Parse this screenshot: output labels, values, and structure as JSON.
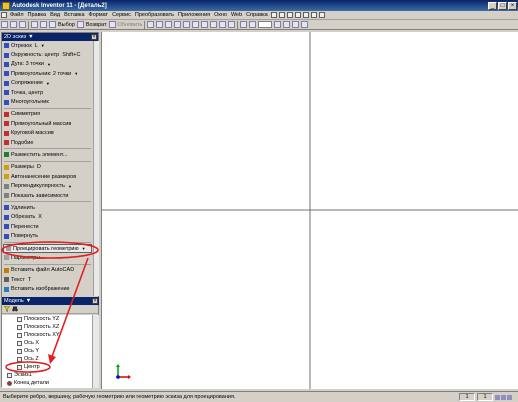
{
  "window": {
    "title": "Autodesk Inventor 11 - [Деталь2]",
    "buttons": {
      "minimize": "_",
      "maximize": "□",
      "close": "×"
    }
  },
  "menu": {
    "items": [
      "Файл",
      "Правка",
      "Вид",
      "Вставка",
      "Формат",
      "Сервис",
      "Преобразовать",
      "Приложения",
      "Окно",
      "Web",
      "Справка"
    ]
  },
  "toolbar": {
    "select_label": "Выбор",
    "return_label": "Возврат",
    "update_label": "Обновить"
  },
  "sketch_panel": {
    "title": "2D эскиз",
    "tools": [
      {
        "label": "Отрезок",
        "shortcut": "L",
        "arrow": "▼"
      },
      {
        "label": "Окружность: центр",
        "shortcut": "Shift+C",
        "arrow": ""
      },
      {
        "label": "Дуга: 3 точки",
        "shortcut": "",
        "arrow": "▼"
      },
      {
        "label": "Прямоугольник: 2 точки",
        "shortcut": "",
        "arrow": "▼"
      },
      {
        "label": "Сопряжение",
        "shortcut": "",
        "arrow": "▼"
      },
      {
        "label": "Точка, центр",
        "shortcut": "",
        "arrow": ""
      },
      {
        "label": "Многоугольник",
        "shortcut": "",
        "arrow": ""
      },
      {
        "label": "Симметрия",
        "shortcut": "",
        "arrow": ""
      },
      {
        "label": "Прямоугольный массив",
        "shortcut": "",
        "arrow": ""
      },
      {
        "label": "Круговой массив",
        "shortcut": "",
        "arrow": ""
      },
      {
        "label": "Подобие",
        "shortcut": "",
        "arrow": ""
      },
      {
        "label": "Разместить элемент...",
        "shortcut": "",
        "arrow": ""
      },
      {
        "label": "Размеры",
        "shortcut": "D",
        "arrow": ""
      },
      {
        "label": "Автонанесение размеров",
        "shortcut": "",
        "arrow": ""
      },
      {
        "label": "Перпендикулярность",
        "shortcut": "",
        "arrow": "▼"
      },
      {
        "label": "Показать зависимости",
        "shortcut": "",
        "arrow": ""
      },
      {
        "label": "Удлинить",
        "shortcut": "",
        "arrow": ""
      },
      {
        "label": "Обрезать",
        "shortcut": "X",
        "arrow": ""
      },
      {
        "label": "Перенести",
        "shortcut": "",
        "arrow": ""
      },
      {
        "label": "Повернуть",
        "shortcut": "",
        "arrow": ""
      },
      {
        "label": "Проецировать геометрию",
        "shortcut": "",
        "arrow": "▼"
      },
      {
        "label": "Параметры...",
        "shortcut": "",
        "arrow": ""
      },
      {
        "label": "Вставить файл AutoCAD",
        "shortcut": "",
        "arrow": ""
      },
      {
        "label": "Текст",
        "shortcut": "T",
        "arrow": ""
      },
      {
        "label": "Вставить изображение",
        "shortcut": "",
        "arrow": ""
      }
    ]
  },
  "model_panel": {
    "title": "Модель",
    "tree": [
      {
        "label": "Плоскость YZ",
        "indent": 3
      },
      {
        "label": "Плоскость XZ",
        "indent": 3
      },
      {
        "label": "Плоскость XY",
        "indent": 3
      },
      {
        "label": "Ось X",
        "indent": 3
      },
      {
        "label": "Ось Y",
        "indent": 3
      },
      {
        "label": "Ось Z",
        "indent": 3
      },
      {
        "label": "Центр",
        "indent": 3
      },
      {
        "label": "Эскиз1",
        "indent": 1
      },
      {
        "label": "Конец детали",
        "indent": 1
      }
    ]
  },
  "status": {
    "message": "Выберите ребро, вершину, рабочую геометрию или геометрию эскиза для проецирования.",
    "cell1": "1",
    "cell2": "1"
  },
  "colors": {
    "titlebar": "#0a246a",
    "annotation": "#e02020",
    "axis_x": "#e00000",
    "axis_y": "#00a000",
    "axis_z": "#0000e0"
  }
}
